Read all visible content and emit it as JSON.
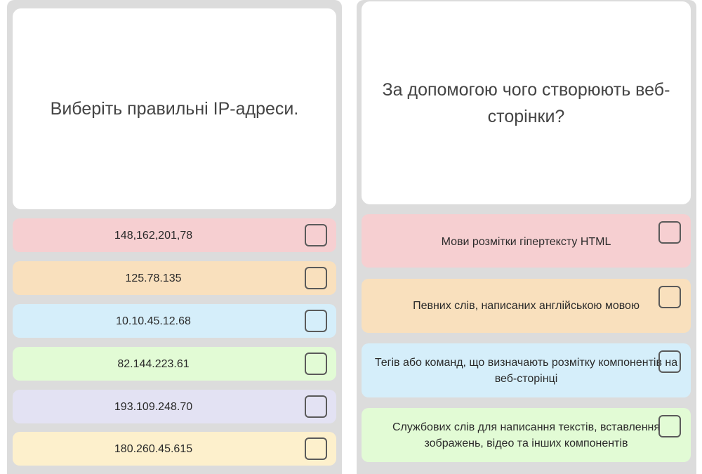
{
  "left_quiz": {
    "question": "Виберіть правильні IP-адреси.",
    "answers": [
      {
        "label": "148,162,201,78",
        "color": "#f6cfd1",
        "checked": false
      },
      {
        "label": "125.78.135",
        "color": "#f9e0bd",
        "checked": false
      },
      {
        "label": "10.10.45.12.68",
        "color": "#d5eefa",
        "checked": false
      },
      {
        "label": "82.144.223.61",
        "color": "#e2fbd5",
        "checked": false
      },
      {
        "label": "193.109.248.70",
        "color": "#e3e2f3",
        "checked": false
      },
      {
        "label": "180.260.45.615",
        "color": "#fdf0cc",
        "checked": false
      }
    ]
  },
  "right_quiz": {
    "question": "За допомогою чого створюють веб-сторінки?",
    "answers": [
      {
        "label": "Мови розмітки гіпертексту HTML",
        "color": "#f6cfd1",
        "checked": false
      },
      {
        "label": "Певних слів, написаних англійською мовою",
        "color": "#f9e0bd",
        "checked": false
      },
      {
        "label": "Тегів або команд, що визначають розмітку компонентів на веб-сторінці",
        "color": "#d5eefa",
        "checked": false
      },
      {
        "label": "Службових слів для написання текстів, вставлення зображень, відео та інших компонентів",
        "color": "#e2fbd5",
        "checked": false
      }
    ]
  }
}
